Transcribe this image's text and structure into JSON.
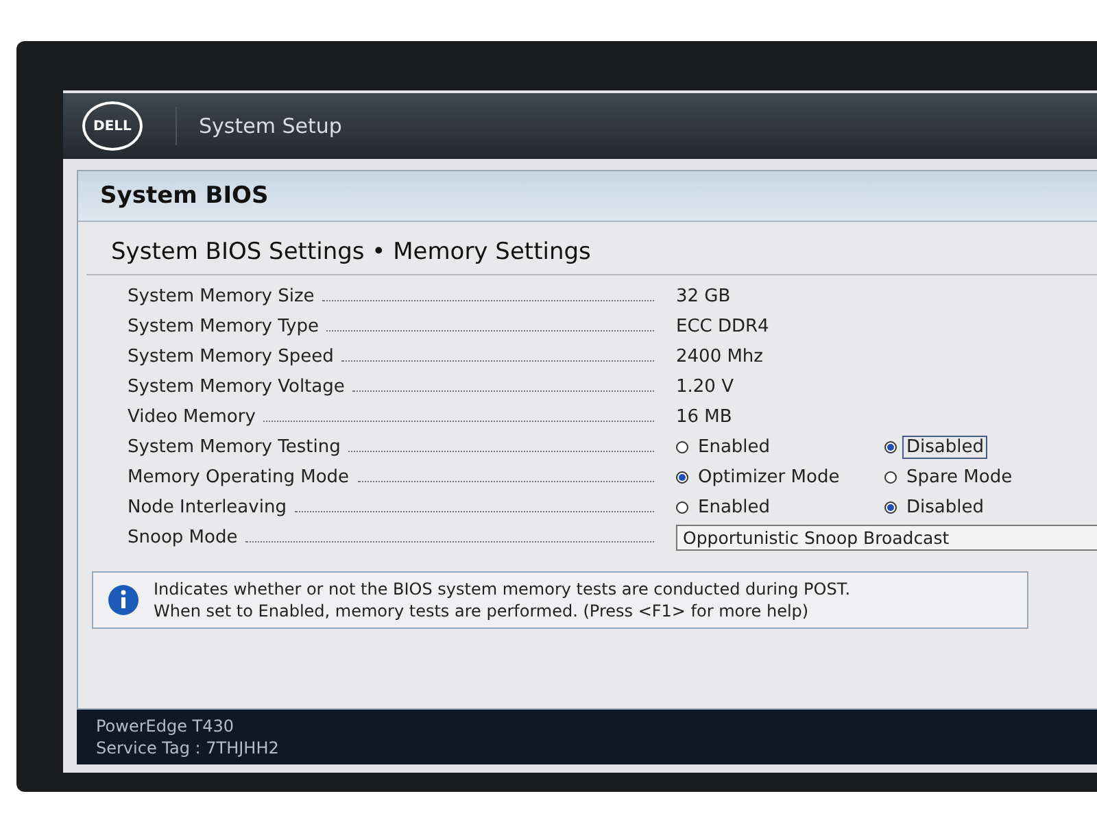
{
  "header": {
    "logo": "DELL",
    "title": "System Setup"
  },
  "panel": {
    "title": "System BIOS",
    "subtitle": "System BIOS Settings • Memory Settings"
  },
  "settings": [
    {
      "kind": "value",
      "label": "System Memory Size",
      "value": "32 GB"
    },
    {
      "kind": "value",
      "label": "System Memory Type",
      "value": "ECC DDR4"
    },
    {
      "kind": "value",
      "label": "System Memory Speed",
      "value": "2400 Mhz"
    },
    {
      "kind": "value",
      "label": "System Memory Voltage",
      "value": "1.20 V"
    },
    {
      "kind": "value",
      "label": "Video Memory",
      "value": "16 MB"
    },
    {
      "kind": "radio",
      "label": "System Memory Testing",
      "options": [
        {
          "label": "Enabled",
          "selected": false,
          "focused": false
        },
        {
          "label": "Disabled",
          "selected": true,
          "focused": true
        }
      ]
    },
    {
      "kind": "radio",
      "label": "Memory Operating Mode",
      "options": [
        {
          "label": "Optimizer Mode",
          "selected": true,
          "focused": false
        },
        {
          "label": "Spare Mode",
          "selected": false,
          "focused": false
        }
      ]
    },
    {
      "kind": "radio",
      "label": "Node Interleaving",
      "options": [
        {
          "label": "Enabled",
          "selected": false,
          "focused": false
        },
        {
          "label": "Disabled",
          "selected": true,
          "focused": false
        }
      ]
    },
    {
      "kind": "select",
      "label": "Snoop Mode",
      "value": "Opportunistic Snoop Broadcast"
    }
  ],
  "help": [
    "Indicates whether or not the BIOS system memory tests are conducted during POST.",
    "When set to Enabled, memory tests are performed. (Press <F1> for more help)"
  ],
  "footer": {
    "model": "PowerEdge T430",
    "service_tag": "Service Tag : 7THJHH2"
  }
}
